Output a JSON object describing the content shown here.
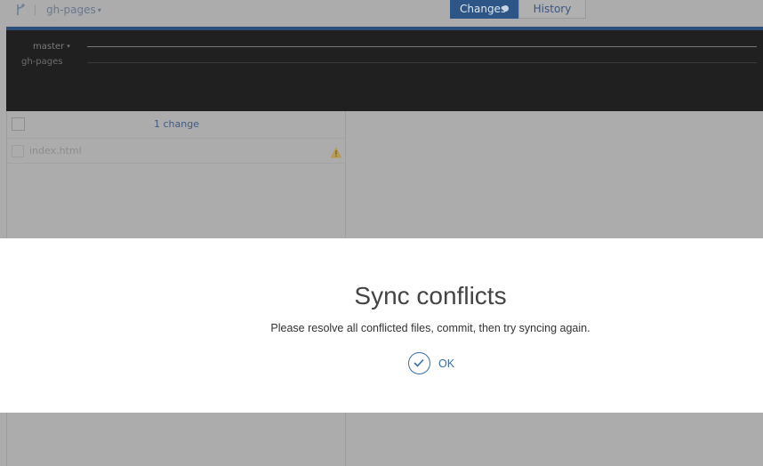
{
  "topbar": {
    "branch_icon": "git-branch-icon",
    "branch_name": "gh-pages",
    "branch_caret": "▾",
    "tabs": [
      {
        "label": "Changes",
        "active": true
      },
      {
        "label": "History",
        "active": false
      }
    ]
  },
  "graph": {
    "branches": [
      {
        "label": "master",
        "caret": "▾"
      },
      {
        "label": "gh-pages"
      }
    ]
  },
  "changes": {
    "count_label": "1 change",
    "files": [
      {
        "name": "index.html",
        "status_icon": "warning-icon"
      }
    ]
  },
  "dialog": {
    "title": "Sync conflicts",
    "message": "Please resolve all conflicted files, commit, then try syncing again.",
    "ok_label": "OK",
    "ok_icon": "checkmark-circle-icon"
  },
  "colors": {
    "accent": "#2d5585",
    "overlay": "#acacac",
    "dialog_background": "#ffffff",
    "ok_color": "#3a6ea5",
    "warning": "#d9a400"
  }
}
